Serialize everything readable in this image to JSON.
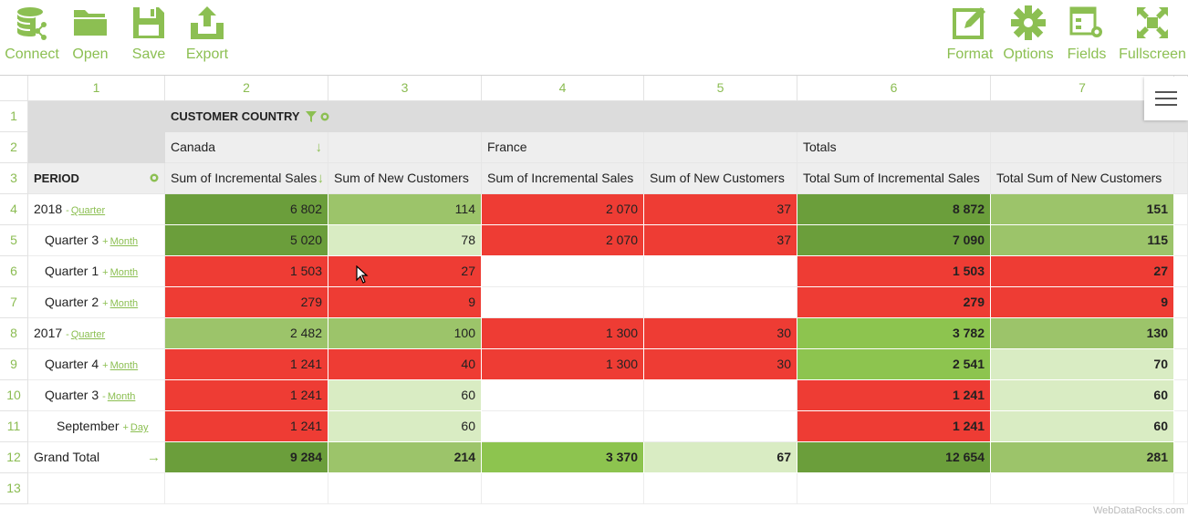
{
  "toolbar": {
    "connect_label": "Connect",
    "open_label": "Open",
    "save_label": "Save",
    "export_label": "Export",
    "format_label": "Format",
    "options_label": "Options",
    "fields_label": "Fields",
    "fullscreen_label": "Fullscreen"
  },
  "colors": {
    "accent": "#8cbf52",
    "dark_green": "#6b9e3b",
    "medium_green": "#8dc44f",
    "light_green": "#9cc46a",
    "pale_green": "#d9ecc3",
    "red": "#ee3c34"
  },
  "grid": {
    "col_numbers": [
      "1",
      "2",
      "3",
      "4",
      "5",
      "6",
      "7"
    ],
    "row_numbers": [
      "1",
      "2",
      "3",
      "4",
      "5",
      "6",
      "7",
      "8",
      "9",
      "10",
      "11",
      "12",
      "13"
    ],
    "customer_country_label": "CUSTOMER COUNTRY",
    "period_label": "PERIOD",
    "countries": {
      "canada": "Canada",
      "france": "France",
      "totals": "Totals"
    },
    "measures": {
      "canada_sales": "Sum of Incremental Sales",
      "canada_customers": "Sum of New Customers",
      "france_sales": "Sum of Incremental Sales",
      "france_customers": "Sum of New Customers",
      "total_sales": "Total Sum of Incremental Sales",
      "total_customers": "Total Sum of New Customers"
    },
    "rows": [
      {
        "label": "2018",
        "link_prefix": "-",
        "link": "Quarter",
        "indent": 0,
        "values": [
          "6 802",
          "114",
          "2 070",
          "37",
          "8 872",
          "151"
        ],
        "fills": [
          "dg",
          "lg",
          "rd",
          "rd",
          "dg",
          "lg"
        ]
      },
      {
        "label": "Quarter 3",
        "link_prefix": "+",
        "link": "Month",
        "indent": 1,
        "values": [
          "5 020",
          "78",
          "2 070",
          "37",
          "7 090",
          "115"
        ],
        "fills": [
          "dg",
          "pg",
          "rd",
          "rd",
          "dg",
          "lg"
        ]
      },
      {
        "label": "Quarter 1",
        "link_prefix": "+",
        "link": "Month",
        "indent": 1,
        "values": [
          "1 503",
          "27",
          "",
          "",
          "1 503",
          "27"
        ],
        "fills": [
          "rd",
          "rd",
          "wh",
          "wh",
          "rd",
          "rd"
        ]
      },
      {
        "label": "Quarter 2",
        "link_prefix": "+",
        "link": "Month",
        "indent": 1,
        "values": [
          "279",
          "9",
          "",
          "",
          "279",
          "9"
        ],
        "fills": [
          "rd",
          "rd",
          "wh",
          "wh",
          "rd",
          "rd"
        ]
      },
      {
        "label": "2017",
        "link_prefix": "-",
        "link": "Quarter",
        "indent": 0,
        "values": [
          "2 482",
          "100",
          "1 300",
          "30",
          "3 782",
          "130"
        ],
        "fills": [
          "lg",
          "lg",
          "rd",
          "rd",
          "mg",
          "lg"
        ]
      },
      {
        "label": "Quarter 4",
        "link_prefix": "+",
        "link": "Month",
        "indent": 1,
        "values": [
          "1 241",
          "40",
          "1 300",
          "30",
          "2 541",
          "70"
        ],
        "fills": [
          "rd",
          "rd",
          "rd",
          "rd",
          "mg",
          "pg"
        ]
      },
      {
        "label": "Quarter 3",
        "link_prefix": "-",
        "link": "Month",
        "indent": 1,
        "values": [
          "1 241",
          "60",
          "",
          "",
          "1 241",
          "60"
        ],
        "fills": [
          "rd",
          "pg",
          "wh",
          "wh",
          "rd",
          "pg"
        ]
      },
      {
        "label": "September",
        "link_prefix": "+",
        "link": "Day",
        "indent": 2,
        "values": [
          "1 241",
          "60",
          "",
          "",
          "1 241",
          "60"
        ],
        "fills": [
          "rd",
          "pg",
          "wh",
          "wh",
          "rd",
          "pg"
        ]
      }
    ],
    "grand_total": {
      "label": "Grand Total",
      "values": [
        "9 284",
        "214",
        "3 370",
        "67",
        "12 654",
        "281"
      ],
      "fills": [
        "dg",
        "lg",
        "mg",
        "pg",
        "dg",
        "lg"
      ]
    }
  },
  "footer_text": "WebDataRocks.com"
}
